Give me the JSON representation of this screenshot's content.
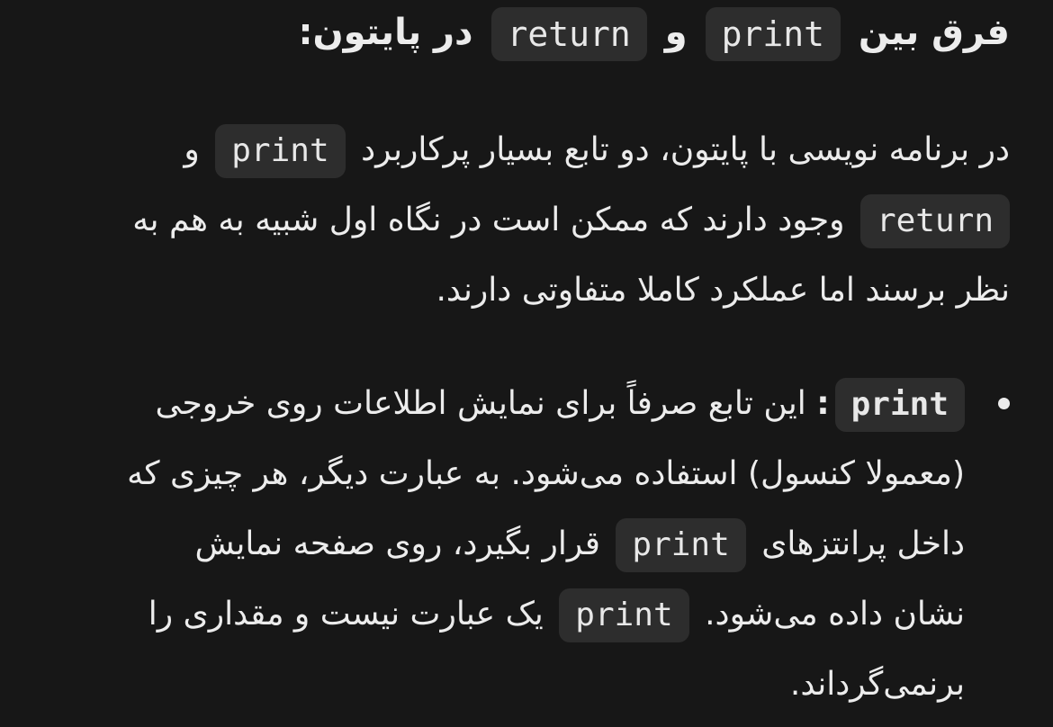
{
  "heading": {
    "part1": "فرق بین",
    "code1": "print",
    "part2": "و",
    "code2": "return",
    "part3": "در پایتون:"
  },
  "intro": {
    "line1_text": "در برنامه نویسی با پایتون، دو تابع بسیار پرکاربرد",
    "line1_code": "print",
    "line1_end": "و",
    "line2_code": "return",
    "line2_text": "وجود دارند که ممکن است در نگاه اول شبیه به هم به",
    "line3_text": "نظر برسند اما عملکرد کاملا متفاوتی دارند."
  },
  "bullet": {
    "code_label": "print",
    "colon": ":",
    "line1_text": "این تابع صرفاً برای نمایش اطلاعات روی خروجی",
    "line2_text": "(معمولا کنسول) استفاده می‌شود. به عبارت دیگر، هر چیزی که",
    "line3_start": "داخل پرانتزهای",
    "line3_code": "print",
    "line3_end": "قرار بگیرد، روی صفحه نمایش",
    "line4_start": "نشان داده می‌شود.",
    "line4_code": "print",
    "line4_end": "یک عبارت نیست و مقداری را",
    "line5_text": "برنمی‌گرداند."
  }
}
